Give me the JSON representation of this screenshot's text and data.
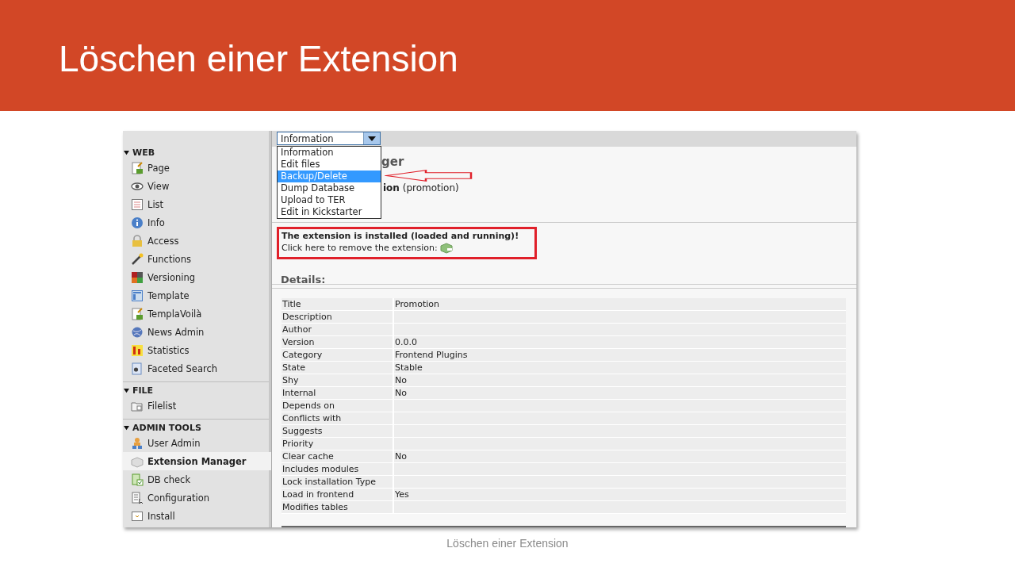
{
  "slide": {
    "title": "Löschen einer Extension",
    "footer": "Löschen einer Extension"
  },
  "sidebar": {
    "groups": [
      {
        "label": "WEB",
        "expanded": true,
        "items": [
          {
            "label": "Page",
            "selected": false
          },
          {
            "label": "View",
            "selected": false
          },
          {
            "label": "List",
            "selected": false
          },
          {
            "label": "Info",
            "selected": false
          },
          {
            "label": "Access",
            "selected": false
          },
          {
            "label": "Functions",
            "selected": false
          },
          {
            "label": "Versioning",
            "selected": false
          },
          {
            "label": "Template",
            "selected": false
          },
          {
            "label": "TemplaVoilà",
            "selected": false
          },
          {
            "label": "News Admin",
            "selected": false
          },
          {
            "label": "Statistics",
            "selected": false
          },
          {
            "label": "Faceted Search",
            "selected": false
          }
        ]
      },
      {
        "label": "FILE",
        "expanded": true,
        "items": [
          {
            "label": "Filelist",
            "selected": false
          }
        ]
      },
      {
        "label": "ADMIN TOOLS",
        "expanded": true,
        "items": [
          {
            "label": "User Admin",
            "selected": false
          },
          {
            "label": "Extension Manager",
            "selected": true
          },
          {
            "label": "DB check",
            "selected": false
          },
          {
            "label": "Configuration",
            "selected": false
          },
          {
            "label": "Install",
            "selected": false
          }
        ]
      }
    ]
  },
  "function_menu": {
    "value": "Information",
    "expanded": true,
    "options": [
      {
        "label": "Information",
        "highlighted": false
      },
      {
        "label": "Edit files",
        "highlighted": false
      },
      {
        "label": "Backup/Delete",
        "highlighted": true
      },
      {
        "label": "Dump Database",
        "highlighted": false
      },
      {
        "label": "Upload to TER",
        "highlighted": false
      },
      {
        "label": "Edit in Kickstarter",
        "highlighted": false
      }
    ]
  },
  "heading_fragment": "ger",
  "subtitle_fragment": "**ion** (promotion)",
  "message": {
    "title": "The extension is installed (loaded and running)!",
    "text": "Click here to remove the extension:"
  },
  "details": {
    "heading": "Details:",
    "rows": [
      {
        "label": "Title",
        "value": "Promotion"
      },
      {
        "label": "Description",
        "value": ""
      },
      {
        "label": "Author",
        "value": ""
      },
      {
        "label": "Version",
        "value": "0.0.0"
      },
      {
        "label": "Category",
        "value": "Frontend Plugins"
      },
      {
        "label": "State",
        "value": "Stable"
      },
      {
        "label": "Shy",
        "value": "No"
      },
      {
        "label": "Internal",
        "value": "No"
      },
      {
        "label": "Depends on",
        "value": ""
      },
      {
        "label": "Conflicts with",
        "value": ""
      },
      {
        "label": "Suggests",
        "value": ""
      },
      {
        "label": "Priority",
        "value": ""
      },
      {
        "label": "Clear cache",
        "value": "No"
      },
      {
        "label": "Includes modules",
        "value": ""
      },
      {
        "label": "Lock installation Type",
        "value": ""
      },
      {
        "label": "Load in frontend",
        "value": "Yes"
      },
      {
        "label": "Modifies tables",
        "value": ""
      }
    ]
  }
}
